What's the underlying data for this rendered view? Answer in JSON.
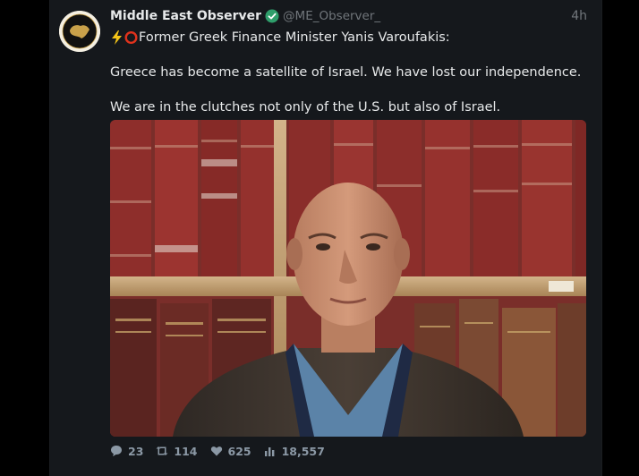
{
  "tweet": {
    "author_name": "Middle East Observer",
    "handle": "@ME_Observer_",
    "timestamp": "4h",
    "verified": true,
    "text_line1": "Former Greek Finance Minister Yanis Varoufakis:",
    "text_line2": "Greece has become a satellite of Israel. We have lost our independence.",
    "text_line3": "We are in the clutches not only of the U.S. but also of Israel.",
    "emojis": [
      "lightning-emoji",
      "red-circle-emoji"
    ],
    "media": {
      "description_icon": "photo-icon"
    },
    "stats": {
      "replies": "23",
      "retweets": "114",
      "likes": "625",
      "views": "18,557"
    }
  },
  "colors": {
    "background": "#000000",
    "card": "#15181c",
    "text": "#e7e9ea",
    "muted": "#71767b",
    "verified": "#2f9e6b"
  }
}
